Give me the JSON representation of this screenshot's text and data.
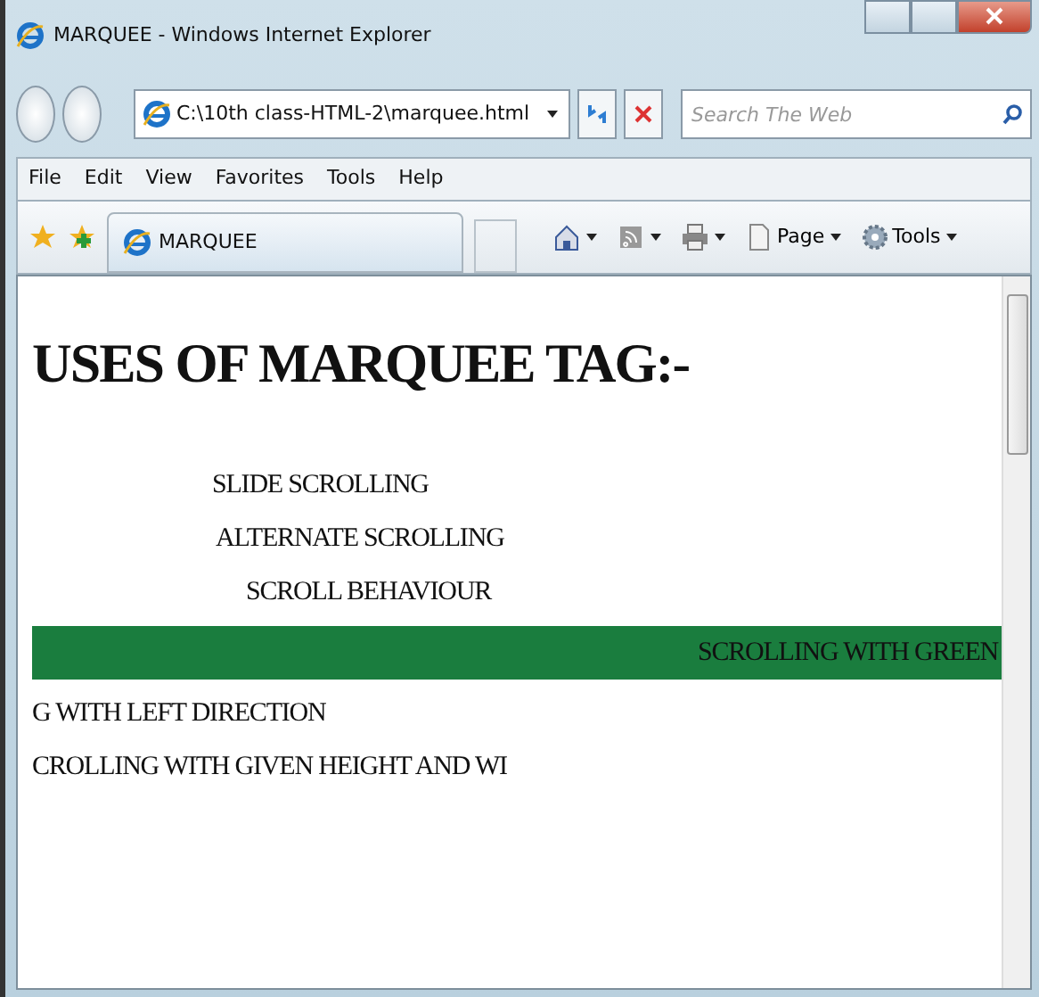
{
  "window": {
    "title": "MARQUEE - Windows Internet Explorer"
  },
  "address_bar": {
    "value": "C:\\10th class-HTML-2\\marquee.html"
  },
  "search": {
    "placeholder": "Search The Web"
  },
  "menu": [
    "File",
    "Edit",
    "View",
    "Favorites",
    "Tools",
    "Help"
  ],
  "tab": {
    "label": "MARQUEE",
    "selected": true
  },
  "command_bar": [
    {
      "kind": "home"
    },
    {
      "kind": "feeds"
    },
    {
      "kind": "print"
    },
    {
      "kind": "page",
      "label": "Page"
    },
    {
      "kind": "tools",
      "label": "Tools"
    }
  ],
  "page": {
    "heading": "USES OF MARQUEE TAG:-",
    "marquees": [
      {
        "text": "SLIDE SCROLLING"
      },
      {
        "text": "ALTERNATE SCROLLING"
      },
      {
        "text": "SCROLL BEHAVIOUR"
      },
      {
        "text": "SCROLLING WITH GREEN",
        "color": "#1a7d3e"
      },
      {
        "text": "G WITH LEFT DIRECTION"
      },
      {
        "text": "CROLLING WITH GIVEN HEIGHT AND WI"
      }
    ]
  }
}
